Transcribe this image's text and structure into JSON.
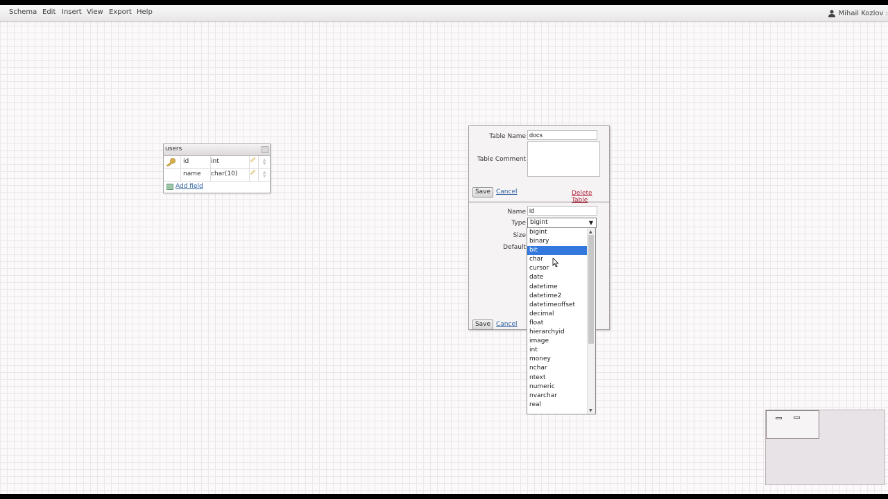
{
  "menu": {
    "items": [
      "Schema",
      "Edit",
      "Insert",
      "View",
      "Export",
      "Help"
    ],
    "user": "Mihail Kozlov :"
  },
  "users_table": {
    "title": "users",
    "fields": [
      {
        "name": "id",
        "type": "int",
        "primary_key": true
      },
      {
        "name": "name",
        "type": "char(10)",
        "primary_key": false
      }
    ],
    "add_field_label": "Add field"
  },
  "table_editor": {
    "table_name_label": "Table Name",
    "table_name_value": "docs",
    "table_comment_label": "Table Comment",
    "table_comment_value": "",
    "save_label": "Save",
    "cancel_label": "Cancel",
    "delete_label": "Delete Table"
  },
  "field_editor": {
    "name_label": "Name",
    "name_value": "id",
    "type_label": "Type",
    "type_value": "bigint",
    "size_label": "Size",
    "default_label": "Default",
    "save_label": "Save",
    "cancel_label": "Cancel"
  },
  "type_dropdown": {
    "highlighted": "bit",
    "options": [
      "bigint",
      "binary",
      "bit",
      "char",
      "cursor",
      "date",
      "datetime",
      "datetime2",
      "datetimeoffset",
      "decimal",
      "float",
      "hierarchyid",
      "image",
      "int",
      "money",
      "nchar",
      "ntext",
      "numeric",
      "nvarchar",
      "real"
    ]
  },
  "colors": {
    "highlight": "#3378dc",
    "link": "#2a5d9a",
    "danger_link": "#b0233a"
  }
}
